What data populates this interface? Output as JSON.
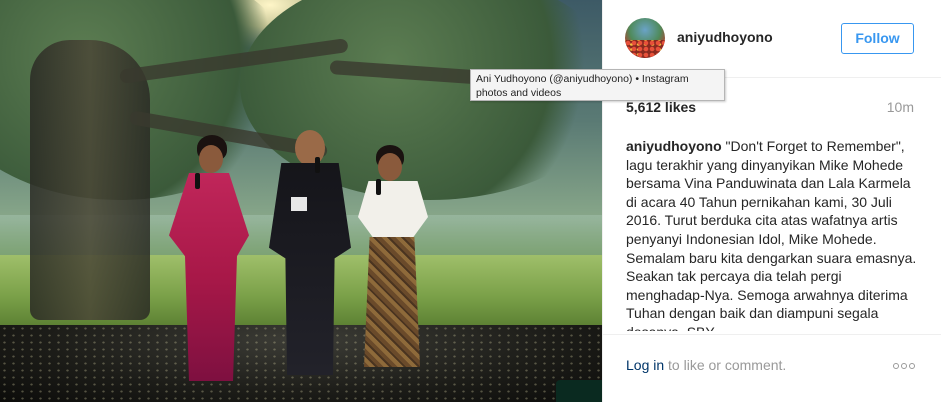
{
  "post": {
    "username": "aniyudhoyono",
    "follow_label": "Follow",
    "likes": "5,612 likes",
    "time_ago": "10m",
    "caption_user": "aniyudhoyono",
    "caption_text": " \"Don't Forget to Remember\", lagu terakhir yang dinyanyikan Mike Mohede bersama Vina Panduwinata dan Lala Karmela di acara 40 Tahun pernikahan kami, 30 Juli 2016. Turut berduka cita atas wafatnya artis penyanyi Indonesian Idol, Mike Mohede. Semalam baru kita dengarkan suara emasnya. Seakan tak percaya dia telah pergi menghadap-Nya. Semoga arwahnya diterima Tuhan dengan baik dan diampuni segala dosanya. SBY,",
    "login_link": "Log in",
    "login_rest": " to like or comment."
  },
  "tooltip": {
    "text": "Ani Yudhoyono (@aniyudhoyono) • Instagram photos and videos"
  },
  "colors": {
    "accent": "#3897f0",
    "link": "#003569",
    "muted": "#999999",
    "text": "#262626"
  },
  "icons": {
    "more": "more-options-icon"
  }
}
